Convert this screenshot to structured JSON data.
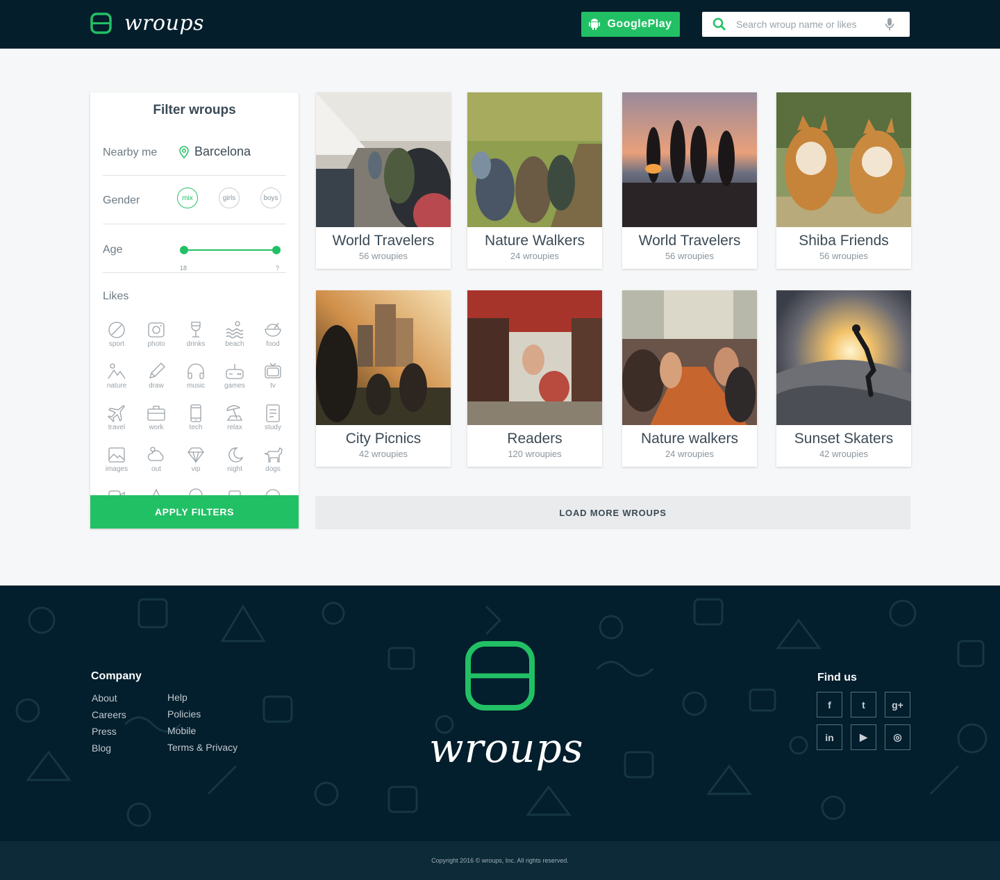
{
  "colors": {
    "accent": "#22c065",
    "navy": "#041e2c",
    "text": "#3b4a55"
  },
  "header": {
    "logo_text": "wroups",
    "gplay_label": "GooglePlay",
    "search_placeholder": "Search wroup name or likes"
  },
  "filter": {
    "title": "Filter wroups",
    "nearby_label": "Nearby me",
    "location": "Barcelona",
    "gender_label": "Gender",
    "gender_options": [
      "mix",
      "girls",
      "boys"
    ],
    "gender_selected": "mix",
    "age_label": "Age",
    "age_min": "18",
    "age_max": "?",
    "likes_label": "Likes",
    "likes": [
      {
        "label": "sport",
        "icon": "sport-icon"
      },
      {
        "label": "photo",
        "icon": "photo-icon"
      },
      {
        "label": "drinks",
        "icon": "drinks-icon"
      },
      {
        "label": "beach",
        "icon": "beach-icon"
      },
      {
        "label": "food",
        "icon": "food-icon"
      },
      {
        "label": "nature",
        "icon": "nature-icon"
      },
      {
        "label": "draw",
        "icon": "draw-icon"
      },
      {
        "label": "music",
        "icon": "music-icon"
      },
      {
        "label": "games",
        "icon": "games-icon"
      },
      {
        "label": "tv",
        "icon": "tv-icon"
      },
      {
        "label": "travel",
        "icon": "travel-icon"
      },
      {
        "label": "work",
        "icon": "work-icon"
      },
      {
        "label": "tech",
        "icon": "tech-icon"
      },
      {
        "label": "relax",
        "icon": "relax-icon"
      },
      {
        "label": "study",
        "icon": "study-icon"
      },
      {
        "label": "images",
        "icon": "images-icon"
      },
      {
        "label": "out",
        "icon": "out-icon"
      },
      {
        "label": "vip",
        "icon": "vip-icon"
      },
      {
        "label": "night",
        "icon": "night-icon"
      },
      {
        "label": "dogs",
        "icon": "dogs-icon"
      }
    ],
    "apply_label": "APPLY FILTERS"
  },
  "groups": [
    {
      "title": "World Travelers",
      "count": "56 wroupies"
    },
    {
      "title": "Nature Walkers",
      "count": "24 wroupies"
    },
    {
      "title": "World Travelers",
      "count": "56 wroupies"
    },
    {
      "title": "Shiba Friends",
      "count": "56 wroupies"
    },
    {
      "title": "City Picnics",
      "count": "42 wroupies"
    },
    {
      "title": "Readers",
      "count": "120 wroupies"
    },
    {
      "title": "Nature walkers",
      "count": "24 wroupies"
    },
    {
      "title": "Sunset Skaters",
      "count": "42 wroupies"
    }
  ],
  "load_more_label": "LOAD MORE WROUPS",
  "footer": {
    "company_title": "Company",
    "col1": [
      "About",
      "Careers",
      "Press",
      "Blog"
    ],
    "col2": [
      "Help",
      "Policies",
      "Mobile",
      "Terms & Privacy"
    ],
    "logo_text": "wroups",
    "find_us_title": "Find us",
    "social": [
      {
        "label": "f",
        "icon": "facebook-icon"
      },
      {
        "label": "t",
        "icon": "twitter-icon"
      },
      {
        "label": "g+",
        "icon": "googleplus-icon"
      },
      {
        "label": "in",
        "icon": "linkedin-icon"
      },
      {
        "label": "▶",
        "icon": "youtube-icon"
      },
      {
        "label": "◎",
        "icon": "instagram-icon"
      }
    ],
    "copyright": "Copyright 2016 © wroups, Inc. All rights reserved."
  }
}
